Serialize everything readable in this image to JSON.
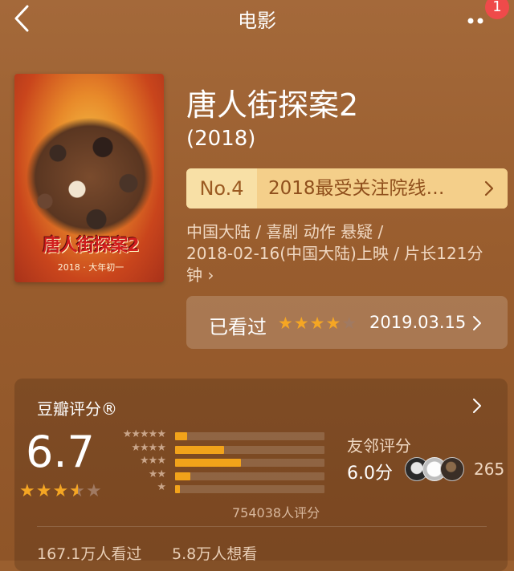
{
  "nav": {
    "title": "电影",
    "badge": "1"
  },
  "movie": {
    "poster_title": "唐人街探案2",
    "poster_date": "2018 · 大年初一",
    "title": "唐人街探案2",
    "year": "(2018)",
    "rank_no": "No.4",
    "rank_text": "2018最受关注院线…",
    "meta_line1": "中国大陆 / 喜剧 动作 悬疑 /",
    "meta_line2": "2018-02-16(中国大陆)上映 / 片长121分",
    "meta_line3": "钟 ›"
  },
  "watched": {
    "label": "已看过",
    "my_rating": 4,
    "max_rating": 5,
    "date": "2019.03.15"
  },
  "rating": {
    "title": "豆瓣评分®",
    "score": "6.7",
    "score_stars": 3.5,
    "distribution_percent": [
      8,
      33,
      44,
      10,
      3
    ],
    "votes": "754038人评分",
    "friend_label": "友邻评分",
    "friend_score": "6.0分",
    "friend_count": "265",
    "watched_count": "167.1万人看过",
    "want_count": "5.8万人想看"
  },
  "colors": {
    "background": "#9a5f2f",
    "accent_star": "#f5a623",
    "badge": "#ef4a4a",
    "rank_bg": "#f4cf8a"
  },
  "icons": [
    "back-arrow-icon",
    "more-dots-icon",
    "chevron-right-icon",
    "star-icon"
  ]
}
